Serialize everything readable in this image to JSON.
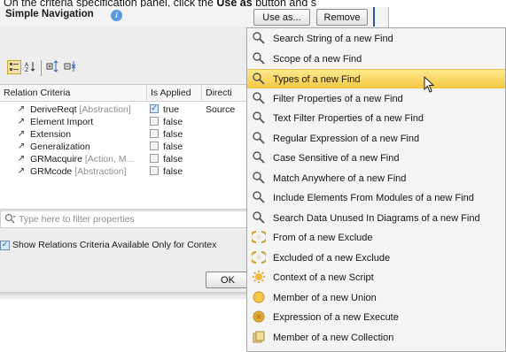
{
  "caption": {
    "prefix": "On the criteria specification panel, click the ",
    "bold": "Use as",
    "suffix": " button and s"
  },
  "dialog": {
    "title": "Simple Navigation",
    "use_as_label": "Use as...",
    "remove_label": "Remove",
    "ok_label": "OK"
  },
  "table": {
    "headers": [
      "Relation Criteria",
      "Is Applied",
      "Directi"
    ],
    "rows": [
      {
        "name": "DeriveReqt",
        "stereo": "[Abstraction]",
        "applied": "true",
        "checked": true,
        "direction": "Source",
        "icon": "derive-icon"
      },
      {
        "name": "Element Import",
        "stereo": "",
        "applied": "false",
        "checked": false,
        "direction": "",
        "icon": "import-icon"
      },
      {
        "name": "Extension",
        "stereo": "",
        "applied": "false",
        "checked": false,
        "direction": "",
        "icon": "extension-icon"
      },
      {
        "name": "Generalization",
        "stereo": "",
        "applied": "false",
        "checked": false,
        "direction": "",
        "icon": "generalization-icon"
      },
      {
        "name": "GRMacquire",
        "stereo": "[Action, M...",
        "applied": "false",
        "checked": false,
        "direction": "",
        "icon": "grm-icon"
      },
      {
        "name": "GRMcode",
        "stereo": "[Abstraction]",
        "applied": "false",
        "checked": false,
        "direction": "",
        "icon": "grm-icon"
      }
    ]
  },
  "filter": {
    "placeholder": "Type here to filter properties"
  },
  "show_relations": {
    "label": "Show Relations Criteria Available Only for Contex",
    "checked": true
  },
  "menu": {
    "items": [
      {
        "label": "Search String of a new Find",
        "icon": "search-icon",
        "highlighted": false
      },
      {
        "label": "Scope of a new Find",
        "icon": "search-icon",
        "highlighted": false
      },
      {
        "label": "Types of a new Find",
        "icon": "search-icon",
        "highlighted": true
      },
      {
        "label": "Filter Properties of a new Find",
        "icon": "search-icon",
        "highlighted": false
      },
      {
        "label": "Text Filter Properties of a new Find",
        "icon": "search-icon",
        "highlighted": false
      },
      {
        "label": "Regular Expression of a new Find",
        "icon": "search-icon",
        "highlighted": false
      },
      {
        "label": "Case Sensitive of a new Find",
        "icon": "search-icon",
        "highlighted": false
      },
      {
        "label": "Match Anywhere of a new Find",
        "icon": "search-icon",
        "highlighted": false
      },
      {
        "label": "Include Elements From Modules of a new Find",
        "icon": "search-icon",
        "highlighted": false
      },
      {
        "label": "Search Data Unused In Diagrams of a new Find",
        "icon": "search-icon",
        "highlighted": false
      },
      {
        "label": "From of a new Exclude",
        "icon": "exclude-icon",
        "highlighted": false
      },
      {
        "label": "Excluded of a new Exclude",
        "icon": "exclude-icon",
        "highlighted": false
      },
      {
        "label": "Context of a new Script",
        "icon": "script-icon",
        "highlighted": false
      },
      {
        "label": "Member of a new Union",
        "icon": "union-icon",
        "highlighted": false
      },
      {
        "label": "Expression of a new Execute",
        "icon": "execute-icon",
        "highlighted": false
      },
      {
        "label": "Member of a new Collection",
        "icon": "collection-icon",
        "highlighted": false
      }
    ]
  },
  "colors": {
    "highlight": "#f5c842",
    "info": "#5b9ae0",
    "accent_blue": "#1a5cb0"
  }
}
